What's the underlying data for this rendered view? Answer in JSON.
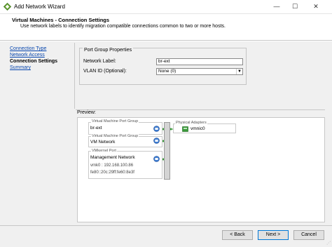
{
  "window": {
    "title": "Add Network Wizard",
    "minimize_glyph": "—",
    "maximize_glyph": "☐",
    "close_glyph": "✕"
  },
  "header": {
    "title": "Virtual Machines - Connection Settings",
    "subtitle": "Use network labels to identify migration compatible connections common to two or more hosts."
  },
  "nav": {
    "items": [
      {
        "label": "Connection Type",
        "state": "link"
      },
      {
        "label": "Network Access",
        "state": "link"
      },
      {
        "label": "Connection Settings",
        "state": "current"
      },
      {
        "label": "Summary",
        "state": "link"
      }
    ]
  },
  "port_group_properties": {
    "legend": "Port Group Properties",
    "network_label_label": "Network Label:",
    "network_label_value": "br-ext",
    "vlan_label": "VLAN ID (Optional):",
    "vlan_value": "None (0)"
  },
  "preview": {
    "label": "Preview:",
    "groups": [
      {
        "title": "Virtual Machine Port Group",
        "name": "br-ext"
      },
      {
        "title": "Virtual Machine Port Group",
        "name": "VM Network"
      },
      {
        "title": "VMkernel Port",
        "name": "Management Network",
        "line2": "vmk0 : 192.168.100.86",
        "line3": "fe80::20c:29ff:fe60:8e3f"
      }
    ],
    "physical_adapters": {
      "title": "Physical Adapters",
      "nic": "vmnic0"
    }
  },
  "footer": {
    "back_label": "< Back",
    "next_label": "Next >",
    "cancel_label": "Cancel"
  },
  "colors": {
    "link": "#0645ad",
    "accent_green": "#3a9a3a",
    "dialog_bg": "#f0f0f0"
  },
  "icons": [
    "vsphere-logo-icon",
    "minimize-icon",
    "maximize-icon",
    "close-icon",
    "port-group-icon",
    "nic-icon"
  ]
}
